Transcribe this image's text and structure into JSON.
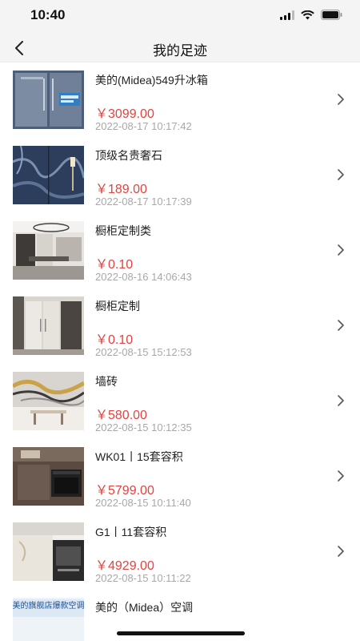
{
  "status": {
    "time": "10:40"
  },
  "nav": {
    "title": "我的足迹"
  },
  "items": [
    {
      "title": "美的(Midea)549升冰箱",
      "price": "￥3099.00",
      "time": "2022-08-17 10:17:42",
      "image": "fridge"
    },
    {
      "title": "顶级名贵奢石",
      "price": "￥189.00",
      "time": "2022-08-17 10:17:39",
      "image": "marble-stone"
    },
    {
      "title": "橱柜定制类",
      "price": "￥0.10",
      "time": "2022-08-16 14:06:43",
      "image": "kitchen-room"
    },
    {
      "title": "橱柜定制",
      "price": "￥0.10",
      "time": "2022-08-15 15:12:53",
      "image": "wardrobe"
    },
    {
      "title": "墙砖",
      "price": "￥580.00",
      "time": "2022-08-15 10:12:35",
      "image": "wall-tile"
    },
    {
      "title": "WK01丨15套容积",
      "price": "￥5799.00",
      "time": "2022-08-15 10:11:40",
      "image": "built-in-oven"
    },
    {
      "title": "G1丨11套容积",
      "price": "￥4929.00",
      "time": "2022-08-15 10:11:22",
      "image": "dishwasher"
    },
    {
      "title": "美的（Midea）空调",
      "banner_text": "美的旗舰店爆款空调",
      "image": "air-conditioner"
    }
  ]
}
